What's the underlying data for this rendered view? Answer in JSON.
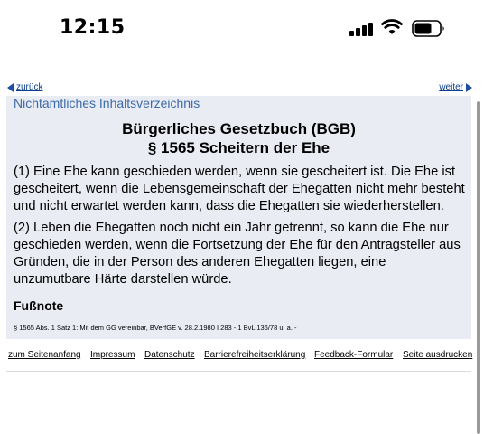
{
  "status": {
    "time": "12:15",
    "icons": [
      "signal-icon",
      "wifi-icon",
      "battery-icon"
    ]
  },
  "nav": {
    "back_label": "zurück",
    "next_label": "weiter",
    "toc_label": "Nichtamtliches Inhaltsverzeichnis"
  },
  "law": {
    "title": "Bürgerliches Gesetzbuch (BGB)",
    "section": "§ 1565 Scheitern der Ehe",
    "paragraphs": [
      "(1) Eine Ehe kann geschieden werden, wenn sie gescheitert ist. Die Ehe ist gescheitert, wenn die Lebensgemeinschaft der Ehegatten nicht mehr besteht und nicht erwartet werden kann, dass die Ehegatten sie wiederherstellen.",
      "(2) Leben die Ehegatten noch nicht ein Jahr getrennt, so kann die Ehe nur geschieden werden, wenn die Fortsetzung der Ehe für den Antragsteller aus Gründen, die in der Person des anderen Ehegatten liegen, eine unzumutbare Härte darstellen würde."
    ],
    "footnote_heading": "Fußnote",
    "footnote_text": "§ 1565 Abs. 1 Satz 1: Mit dem GG vereinbar, BVerfGE v. 28.2.1980 I 283 - 1 BvL 136/78 u. a. -"
  },
  "footer": {
    "links": [
      "zum Seitenanfang",
      "Impressum",
      "Datenschutz",
      "Barrierefreiheitserklärung",
      "Feedback-Formular",
      "Seite ausdrucken"
    ]
  },
  "colors": {
    "content_background": "#e9ecf3",
    "link": "#3d6aa8",
    "nav_arrow": "#1f4fa3"
  }
}
